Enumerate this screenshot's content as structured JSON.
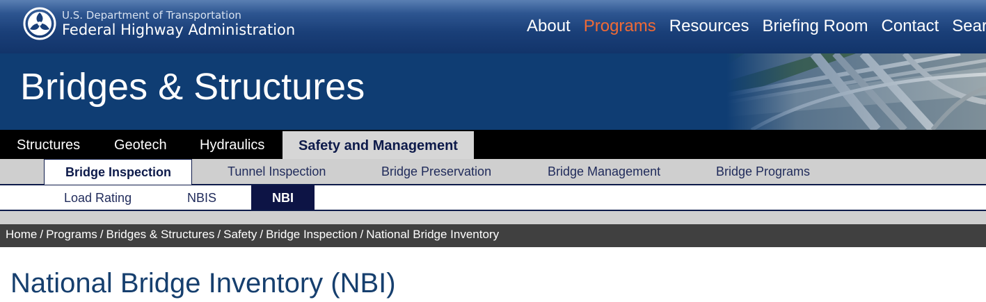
{
  "header": {
    "agency_sub": "U.S. Department of Transportation",
    "agency_main": "Federal Highway Administration",
    "logo_icon": "fhwa-logo-icon",
    "nav": [
      {
        "label": "About",
        "active": false
      },
      {
        "label": "Programs",
        "active": true
      },
      {
        "label": "Resources",
        "active": false
      },
      {
        "label": "Briefing Room",
        "active": false
      },
      {
        "label": "Contact",
        "active": false
      },
      {
        "label": "Search",
        "active": false
      }
    ],
    "active_color": "#f06a35"
  },
  "banner": {
    "title": "Bridges & Structures",
    "image": "highway-interchange-aerial-photo"
  },
  "section_tabs": [
    {
      "label": "Structures",
      "active": false
    },
    {
      "label": "Geotech",
      "active": false
    },
    {
      "label": "Hydraulics",
      "active": false
    },
    {
      "label": "Safety and Management",
      "active": true
    }
  ],
  "sub_tabs": [
    {
      "label": "Bridge Inspection",
      "active": true
    },
    {
      "label": "Tunnel Inspection",
      "active": false
    },
    {
      "label": "Bridge Preservation",
      "active": false
    },
    {
      "label": "Bridge Management",
      "active": false
    },
    {
      "label": "Bridge Programs",
      "active": false
    }
  ],
  "third_tabs": [
    {
      "label": "Load Rating",
      "active": false
    },
    {
      "label": "NBIS",
      "active": false
    },
    {
      "label": "NBI",
      "active": true
    }
  ],
  "breadcrumb": [
    "Home",
    "Programs",
    "Bridges & Structures",
    "Safety",
    "Bridge Inspection",
    "National Bridge Inventory"
  ],
  "breadcrumb_separator": "/",
  "page_title": "National Bridge Inventory (NBI)"
}
